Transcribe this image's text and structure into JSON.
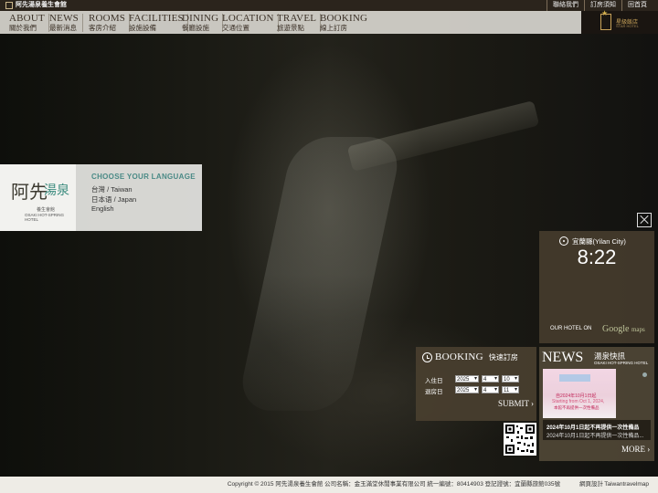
{
  "topbar": {
    "site_name": "阿先湯泉養生會館",
    "links": [
      "聯絡我們",
      "訂房須知",
      "回首頁"
    ]
  },
  "nav": {
    "items": [
      {
        "en": "ABOUT",
        "zh": "關於我們"
      },
      {
        "en": "NEWS",
        "zh": "最新消息"
      },
      {
        "en": "ROOMS",
        "zh": "客房介紹"
      },
      {
        "en": "FACILITIES",
        "zh": "設施設備"
      },
      {
        "en": "DINING",
        "zh": "餐廳設施"
      },
      {
        "en": "LOCATION",
        "zh": "交通位置"
      },
      {
        "en": "TRAVEL",
        "zh": "旅遊景點"
      },
      {
        "en": "BOOKING",
        "zh": "線上訂房"
      }
    ],
    "brand_zh": "星級飯店",
    "brand_en": "STAR HOTEL"
  },
  "language": {
    "logo_main": "阿先",
    "logo_accent": "湯泉",
    "logo_sub_zh": "養生會館",
    "logo_sub_en": "OSAKI HOT-SPRING HOTEL",
    "title": "CHOOSE YOUR LANGUAGE",
    "options": [
      "台灣 / Taiwan",
      "日本语 / Japan",
      "English"
    ]
  },
  "clock": {
    "city": "宜蘭縣(Yilan City)",
    "time": "8:22",
    "our_hotel": "OUR HOTEL ON",
    "maps_label": "Google",
    "maps_suffix": "maps"
  },
  "booking": {
    "title_en": "BOOKING",
    "title_zh": "快速訂房",
    "checkin_label": "入住日",
    "checkout_label": "退房日",
    "checkin": {
      "year": "2025",
      "month": "4",
      "day": "10"
    },
    "checkout": {
      "year": "2025",
      "month": "4",
      "day": "11"
    },
    "submit": "SUBMIT"
  },
  "news": {
    "title_en": "NEWS",
    "title_zh": "湯泉快訊",
    "subtitle": "OSAKI HOT-SPRING HOTEL",
    "thumb_line1": "自2024年10月1日起",
    "thumb_line2": "Starting from Oct 1, 2024,",
    "thumb_line3": "本館不再提供一次性備品",
    "headline": "2024年10月1日起不再提供一次性備品",
    "summary": "2024年10月1日起不再提供一次性備品...",
    "more": "MORE"
  },
  "footer": {
    "copyright": "Copyright © 2015 阿先湯泉養生會館 公司名稱：金玉滿堂休閒事業有限公司 統一編號：80414903 登記證號：宜蘭縣旅館035號",
    "design": "網頁設計",
    "credit": "Taiwantravelmap"
  }
}
